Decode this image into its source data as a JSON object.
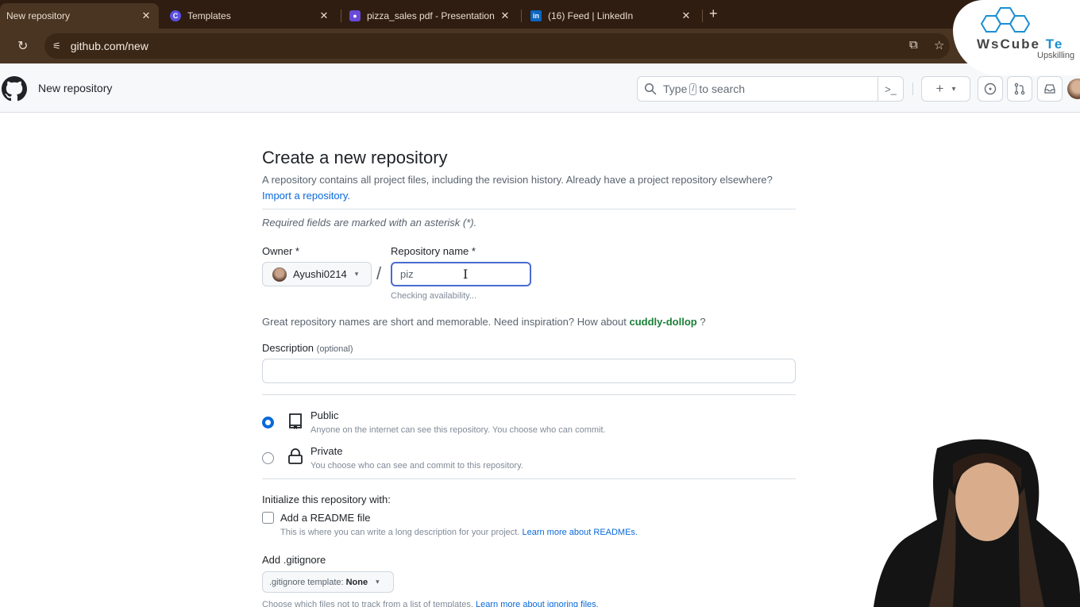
{
  "browser": {
    "tabs": [
      {
        "title": "New repository",
        "active": true,
        "favicon": "github-favicon"
      },
      {
        "title": "Templates",
        "active": false,
        "favicon": "canva-favicon"
      },
      {
        "title": "pizza_sales pdf - Presentation",
        "active": false,
        "favicon": "presentation-favicon"
      },
      {
        "title": "(16) Feed | LinkedIn",
        "active": false,
        "favicon": "linkedin-favicon"
      }
    ],
    "new_tab_label": "+",
    "close_glyph": "✕",
    "url": "github.com/new",
    "icons": {
      "reload": "↻",
      "site_info": "⚟",
      "install": "⧉",
      "bookmark": "☆"
    }
  },
  "watermark": {
    "brand_prefix": "WsCube ",
    "brand_suffix": "Te",
    "tagline": "Upskilling"
  },
  "github_header": {
    "context": "New repository",
    "search_prefix": "Type",
    "search_key": "/",
    "search_suffix": "to search",
    "command_palette_glyph": ">_",
    "create_glyph": "+",
    "caret": "▾",
    "issues_glyph": "⊙",
    "pulls_glyph": "⇅",
    "inbox_glyph": "✉"
  },
  "form": {
    "title": "Create a new repository",
    "subtitle": "A repository contains all project files, including the revision history. Already have a project repository elsewhere?",
    "import_link": "Import a repository.",
    "required_note": "Required fields are marked with an asterisk (*).",
    "owner_label": "Owner *",
    "owner_value": "Ayushi0214",
    "separator": "/",
    "repo_name_label": "Repository name *",
    "repo_name_value": "piz",
    "availability": "Checking availability...",
    "inspiration_text": "Great repository names are short and memorable. Need inspiration? How about",
    "inspiration_suggestion": "cuddly-dollop",
    "inspiration_end": "?",
    "description_label": "Description",
    "description_optional": "(optional)",
    "description_value": "",
    "visibility": [
      {
        "id": "public",
        "title": "Public",
        "desc": "Anyone on the internet can see this repository. You choose who can commit.",
        "selected": true
      },
      {
        "id": "private",
        "title": "Private",
        "desc": "You choose who can see and commit to this repository.",
        "selected": false
      }
    ],
    "init_heading": "Initialize this repository with:",
    "readme_label": "Add a README file",
    "readme_checked": false,
    "readme_desc": "This is where you can write a long description for your project.",
    "readme_link": "Learn more about READMEs.",
    "gitignore_heading": "Add .gitignore",
    "gitignore_prefix": ".gitignore template:",
    "gitignore_value": "None",
    "gitignore_desc": "Choose which files not to track from a list of templates.",
    "gitignore_link": "Learn more about ignoring files."
  }
}
